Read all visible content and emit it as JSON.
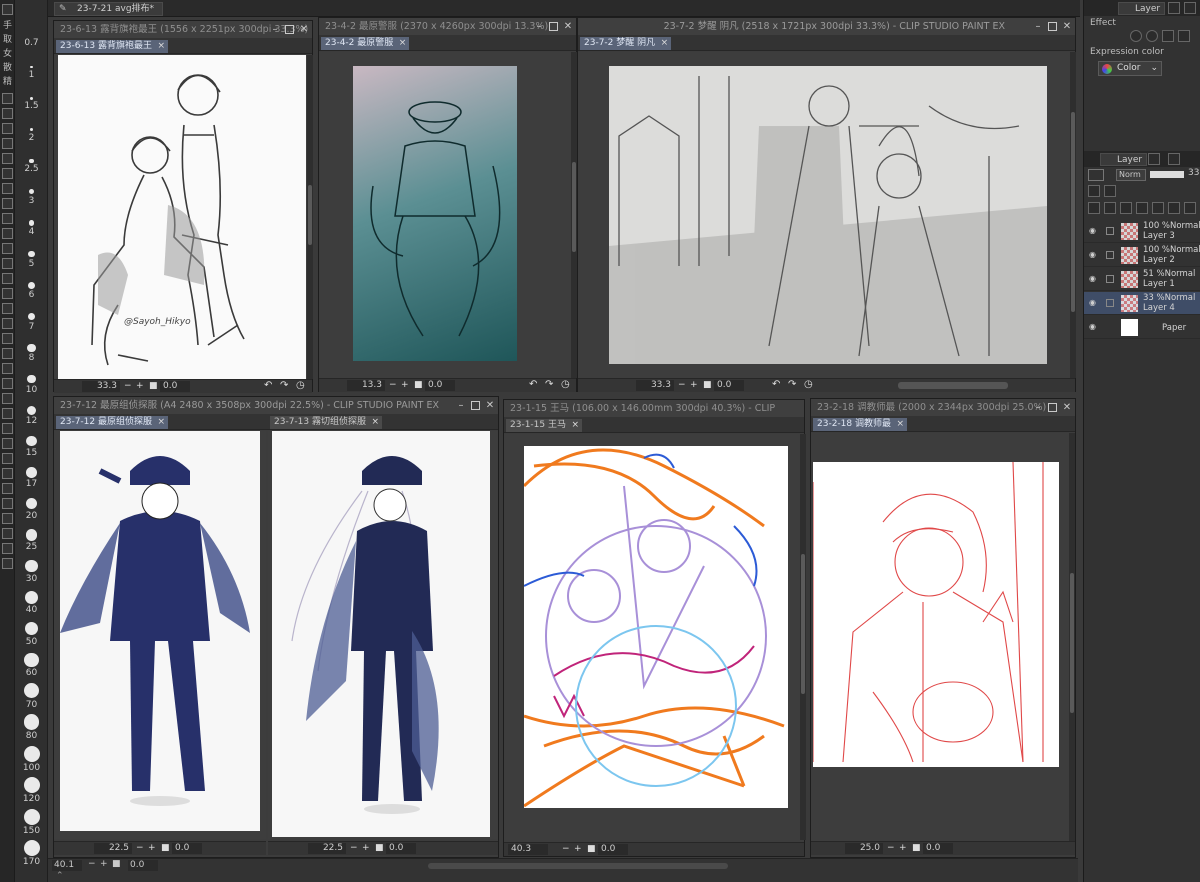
{
  "top_tab": {
    "label": "23-7-21 avg排布*"
  },
  "left_strip": {
    "chars": [
      "手",
      "取",
      "女",
      "散",
      "精"
    ]
  },
  "brush_sizes": [
    "0.7",
    "1",
    "1.5",
    "2",
    "2.5",
    "3",
    "4",
    "5",
    "6",
    "7",
    "8",
    "10",
    "12",
    "15",
    "17",
    "20",
    "25",
    "30",
    "40",
    "50",
    "60",
    "70",
    "80",
    "100",
    "120",
    "150",
    "170"
  ],
  "windows": {
    "w1": {
      "title": "23-6-13 露背旗袍最王 (1556 x 2251px 300dpi 33.3%)",
      "tab": "23-6-13 露背旗袍最王",
      "zoom": "33.3",
      "rotation": "0.0",
      "signature": "@Sayoh_Hikyo"
    },
    "w2": {
      "title": "23-4-2 最原警服 (2370 x 4260px 300dpi 13.3%)",
      "tab": "23-4-2 最原警服",
      "zoom": "13.3",
      "rotation": "0.0"
    },
    "w3": {
      "title": "23-7-2 梦醒 阴凡 (2518 x 1721px 300dpi 33.3%) - CLIP STUDIO PAINT EX",
      "tab": "23-7-2 梦醒 阴凡",
      "zoom": "33.3",
      "rotation": "0.0"
    },
    "w4": {
      "title": "23-7-12 最原组侦探服 (A4 2480 x 3508px 300dpi 22.5%) - CLIP STUDIO PAINT EX",
      "tab1": "23-7-12 最原组侦探服",
      "tab2": "23-7-13 霧切组侦探服",
      "zoom1": "22.5",
      "zoom2": "22.5",
      "rotation": "0.0"
    },
    "w5": {
      "title": "23-1-15 王马 (106.00 x 146.00mm 300dpi 40.3%) - CLIP",
      "tab": "23-1-15 王马",
      "zoom": "40.3",
      "rotation": "0.0"
    },
    "w6": {
      "title": "23-2-18 调教师最 (2000 x 2344px 300dpi 25.0%)",
      "tab": "23-2-18 调教师最",
      "zoom": "25.0",
      "rotation": "0.0"
    }
  },
  "bottom_status": {
    "zoom": "40.1",
    "rotation": "0.0"
  },
  "right_panel": {
    "top_tab": "Layer",
    "effect_label": "Effect",
    "expression_color_label": "Expression color",
    "color_select": "Color",
    "layer_tab": "Layer",
    "blend_select": "Norm",
    "opacity_value": "33",
    "layers": [
      {
        "mode": "100 %Normal",
        "name": "Layer 3",
        "selected": false,
        "paper": false
      },
      {
        "mode": "100 %Normal",
        "name": "Layer 2",
        "selected": false,
        "paper": false
      },
      {
        "mode": "51 %Normal",
        "name": "Layer 1",
        "selected": false,
        "paper": false
      },
      {
        "mode": "33 %Normal",
        "name": "Layer 4",
        "selected": true,
        "paper": false
      },
      {
        "mode": "",
        "name": "Paper",
        "selected": false,
        "paper": true
      }
    ]
  },
  "colors": {
    "accent_tab": "#5a6478",
    "selected_layer": "#3f4d67",
    "panel_bg": "#3a3a3a"
  }
}
